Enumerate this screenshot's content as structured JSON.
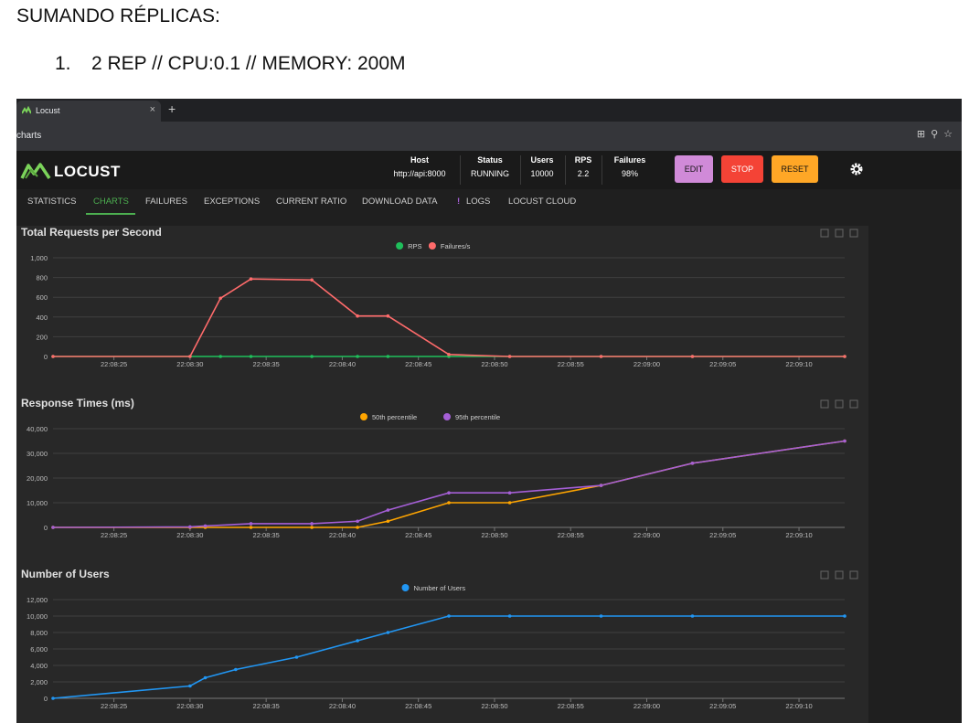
{
  "doc": {
    "heading": "SUMANDO RÉPLICAS:",
    "list_number": "1.",
    "list_text": "2 REP // CPU:0.1 // MEMORY: 200M"
  },
  "browser": {
    "tab_title": "Locust",
    "tab_close": "×",
    "new_tab": "+",
    "url": "charts"
  },
  "header": {
    "brand": "LOCUST",
    "stats": [
      {
        "label": "Host",
        "value": "http://api:8000"
      },
      {
        "label": "Status",
        "value": "RUNNING"
      },
      {
        "label": "Users",
        "value": "10000"
      },
      {
        "label": "RPS",
        "value": "2.2"
      },
      {
        "label": "Failures",
        "value": "98%"
      }
    ],
    "buttons": {
      "edit": "EDIT",
      "stop": "STOP",
      "reset": "RESET"
    }
  },
  "nav": {
    "tabs": [
      "STATISTICS",
      "CHARTS",
      "FAILURES",
      "EXCEPTIONS",
      "CURRENT RATIO",
      "DOWNLOAD DATA",
      "LOGS",
      "LOCUST CLOUD"
    ],
    "active": "CHARTS",
    "logs_badge": "!"
  },
  "colors": {
    "rps": "#1fbf5b",
    "failures": "#ff6b6b",
    "p50": "#ffa500",
    "p95": "#a55fd6",
    "users": "#2196f3",
    "edit_btn": "#d08ad8",
    "stop_btn": "#f44336",
    "reset_btn": "#ffa726"
  },
  "chart_data": [
    {
      "type": "line",
      "title": "Total Requests per Second",
      "x": [
        "22:08:21",
        "22:08:30",
        "22:08:32",
        "22:08:34",
        "22:08:38",
        "22:08:41",
        "22:08:43",
        "22:08:47",
        "22:08:51",
        "22:08:57",
        "22:09:03",
        "22:09:13"
      ],
      "x_ticks": [
        "22:08:25",
        "22:08:30",
        "22:08:35",
        "22:08:40",
        "22:08:45",
        "22:08:50",
        "22:08:55",
        "22:09:00",
        "22:09:05",
        "22:09:10"
      ],
      "ylim": [
        0,
        1000
      ],
      "y_ticks": [
        "0",
        "200",
        "400",
        "600",
        "800",
        "1,000"
      ],
      "legend": "top-center",
      "series": [
        {
          "name": "RPS",
          "values": [
            0,
            0,
            0,
            0,
            0,
            0,
            0,
            0,
            0,
            0,
            0,
            0
          ]
        },
        {
          "name": "Failures/s",
          "values": [
            0,
            0,
            590,
            785,
            775,
            410,
            410,
            20,
            0,
            0,
            0,
            0
          ]
        }
      ]
    },
    {
      "type": "line",
      "title": "Response Times (ms)",
      "x": [
        "22:08:21",
        "22:08:30",
        "22:08:31",
        "22:08:34",
        "22:08:38",
        "22:08:41",
        "22:08:43",
        "22:08:47",
        "22:08:51",
        "22:08:57",
        "22:09:03",
        "22:09:13"
      ],
      "x_ticks": [
        "22:08:25",
        "22:08:30",
        "22:08:35",
        "22:08:40",
        "22:08:45",
        "22:08:50",
        "22:08:55",
        "22:09:00",
        "22:09:05",
        "22:09:10"
      ],
      "ylim": [
        0,
        40000
      ],
      "y_ticks": [
        "0",
        "10,000",
        "20,000",
        "30,000",
        "40,000"
      ],
      "legend": "top-center",
      "series": [
        {
          "name": "50th percentile",
          "values": [
            0,
            0,
            0,
            0,
            0,
            0,
            2500,
            10000,
            10000,
            17000,
            26000,
            35000
          ]
        },
        {
          "name": "95th percentile",
          "values": [
            0,
            200,
            600,
            1500,
            1500,
            2500,
            7000,
            14000,
            14000,
            17000,
            26000,
            35000
          ]
        }
      ]
    },
    {
      "type": "line",
      "title": "Number of Users",
      "x": [
        "22:08:21",
        "22:08:30",
        "22:08:31",
        "22:08:33",
        "22:08:37",
        "22:08:41",
        "22:08:43",
        "22:08:47",
        "22:08:51",
        "22:08:57",
        "22:09:03",
        "22:09:13"
      ],
      "x_ticks": [
        "22:08:25",
        "22:08:30",
        "22:08:35",
        "22:08:40",
        "22:08:45",
        "22:08:50",
        "22:08:55",
        "22:09:00",
        "22:09:05",
        "22:09:10"
      ],
      "ylim": [
        0,
        12000
      ],
      "y_ticks": [
        "0",
        "2,000",
        "4,000",
        "6,000",
        "8,000",
        "10,000",
        "12,000"
      ],
      "legend": "top-center",
      "series": [
        {
          "name": "Number of Users",
          "values": [
            0,
            1500,
            2500,
            3500,
            5000,
            7000,
            8000,
            10000,
            10000,
            10000,
            10000,
            10000
          ]
        }
      ]
    }
  ]
}
